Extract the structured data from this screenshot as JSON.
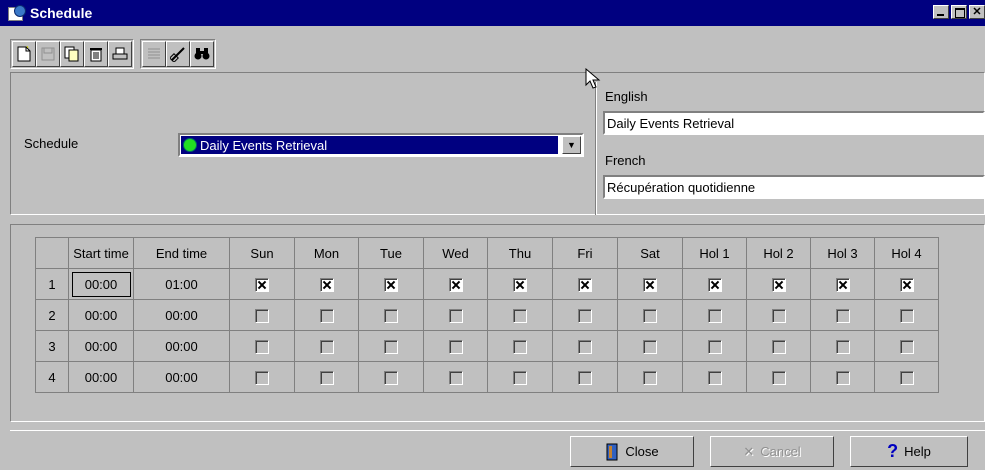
{
  "window": {
    "title": "Schedule"
  },
  "toolbar": {
    "buttons": [
      {
        "icon": "new-document-icon",
        "enabled": true
      },
      {
        "icon": "save-icon",
        "enabled": false
      },
      {
        "icon": "copy-icon",
        "enabled": true
      },
      {
        "icon": "delete-icon",
        "enabled": true
      },
      {
        "icon": "print-icon",
        "enabled": true
      },
      {
        "icon": "list-icon",
        "enabled": false
      },
      {
        "icon": "link-icon",
        "enabled": true
      },
      {
        "icon": "binoculars-icon",
        "enabled": true
      }
    ]
  },
  "schedule": {
    "label": "Schedule",
    "selected": "Daily Events Retrieval",
    "status_color": "#22dd22"
  },
  "names": {
    "english_label": "English",
    "english_value": "Daily Events Retrieval",
    "french_label": "French",
    "french_value": "Récupération quotidienne"
  },
  "grid": {
    "columns": [
      "",
      "Start time",
      "End time",
      "Sun",
      "Mon",
      "Tue",
      "Wed",
      "Thu",
      "Fri",
      "Sat",
      "Hol 1",
      "Hol 2",
      "Hol 3",
      "Hol 4"
    ],
    "rows": [
      {
        "num": "1",
        "start": "00:00",
        "end": "01:00",
        "days": [
          true,
          true,
          true,
          true,
          true,
          true,
          true,
          true,
          true,
          true,
          true
        ]
      },
      {
        "num": "2",
        "start": "00:00",
        "end": "00:00",
        "days": [
          false,
          false,
          false,
          false,
          false,
          false,
          false,
          false,
          false,
          false,
          false
        ]
      },
      {
        "num": "3",
        "start": "00:00",
        "end": "00:00",
        "days": [
          false,
          false,
          false,
          false,
          false,
          false,
          false,
          false,
          false,
          false,
          false
        ]
      },
      {
        "num": "4",
        "start": "00:00",
        "end": "00:00",
        "days": [
          false,
          false,
          false,
          false,
          false,
          false,
          false,
          false,
          false,
          false,
          false
        ]
      }
    ]
  },
  "buttons": {
    "close": "Close",
    "cancel": "Cancel",
    "help": "Help"
  }
}
